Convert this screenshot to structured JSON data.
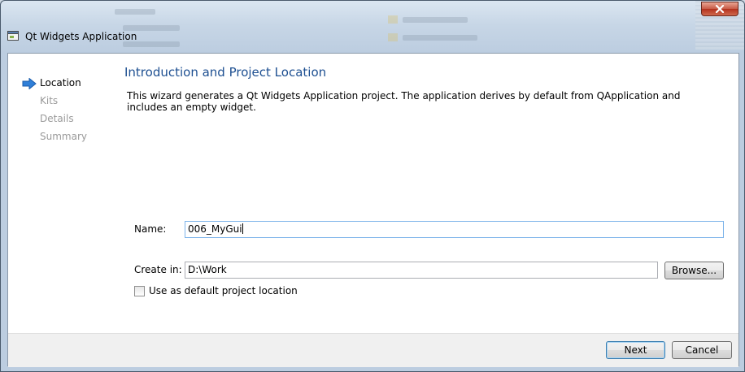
{
  "window": {
    "title": "Qt Widgets Application"
  },
  "nav": {
    "items": [
      {
        "label": "Location"
      },
      {
        "label": "Kits"
      },
      {
        "label": "Details"
      },
      {
        "label": "Summary"
      }
    ]
  },
  "page": {
    "title": "Introduction and Project Location",
    "description": "This wizard generates a Qt Widgets Application project. The application derives by default from QApplication and includes an empty widget."
  },
  "form": {
    "name_label": "Name:",
    "name_value": "006_MyGui",
    "create_in_label": "Create in:",
    "create_in_value": "D:\\Work",
    "browse_label": "Browse...",
    "default_location_label": "Use as default project location",
    "default_location_checked": false
  },
  "footer": {
    "next_label": "Next",
    "cancel_label": "Cancel"
  },
  "colors": {
    "title_blue": "#1d4f91",
    "current_arrow": "#2f7fd8",
    "close_red": "#c75a45"
  },
  "icons": {
    "window_icon": "qt-window-icon",
    "current_step": "arrow-right-icon",
    "close": "close-icon"
  }
}
